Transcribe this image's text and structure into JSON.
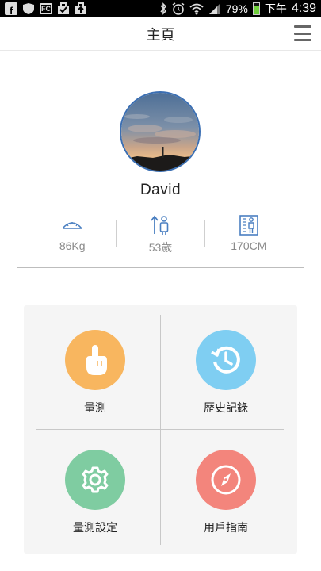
{
  "status_bar": {
    "notification_icons": [
      "facebook-icon",
      "shield-icon",
      "fc-app-icon",
      "check-briefcase-icon",
      "upload-briefcase-icon"
    ],
    "fc_label": "FC",
    "battery_percent": "79%",
    "battery_level": 0.79,
    "period": "下午",
    "time": "4:39",
    "colors": {
      "battery": "#6fcf3a"
    }
  },
  "header": {
    "title": "主頁",
    "menu_icon": "hamburger-menu-icon"
  },
  "profile": {
    "name": "David",
    "stats": [
      {
        "icon": "scale-icon",
        "value": "86Kg"
      },
      {
        "icon": "age-icon",
        "value": "53歲"
      },
      {
        "icon": "height-icon",
        "value": "170CM"
      }
    ]
  },
  "menu": {
    "items": [
      {
        "label": "量測",
        "icon": "pointing-hand-icon",
        "color": "#f8b65f"
      },
      {
        "label": "歷史記錄",
        "icon": "history-clock-icon",
        "color": "#7fcef2"
      },
      {
        "label": "量測設定",
        "icon": "gear-icon",
        "color": "#7fcca1"
      },
      {
        "label": "用戶指南",
        "icon": "compass-icon",
        "color": "#f3857c"
      }
    ]
  },
  "colors": {
    "accent_blue": "#3b6fb3",
    "icon_blue": "#4a7fc1"
  }
}
